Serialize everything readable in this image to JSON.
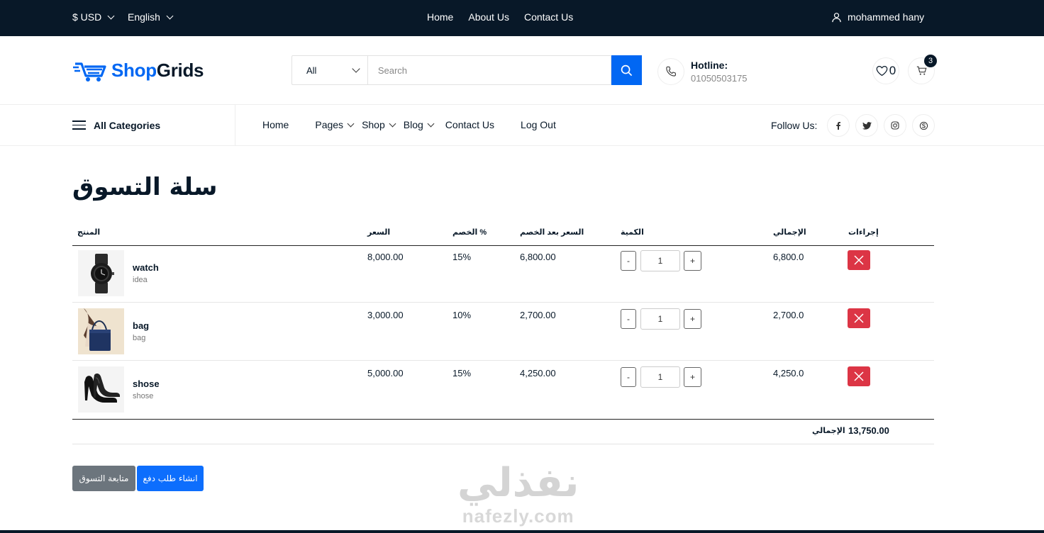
{
  "topbar": {
    "currency": "$ USD",
    "language": "English",
    "nav": [
      "Home",
      "About Us",
      "Contact Us"
    ],
    "user": "mohammed hany"
  },
  "header": {
    "logo_shop": "Shop",
    "logo_grids": "Grids",
    "search_category": "All",
    "search_placeholder": "Search",
    "hotline_label": "Hotline:",
    "hotline_number": "01050503175",
    "wishlist_count": "0",
    "cart_count": "3"
  },
  "navbar": {
    "all_categories": "All Categories",
    "menu": [
      {
        "label": "Home",
        "dropdown": false
      },
      {
        "label": "Pages",
        "dropdown": true
      },
      {
        "label": "Shop",
        "dropdown": true
      },
      {
        "label": "Blog",
        "dropdown": true
      },
      {
        "label": "Contact Us",
        "dropdown": false
      },
      {
        "label": "Log Out",
        "dropdown": false
      }
    ],
    "follow_label": "Follow Us:",
    "social_icons": [
      "facebook-icon",
      "twitter-icon",
      "instagram-icon",
      "skype-icon"
    ]
  },
  "cart": {
    "title": "سلة التسوق",
    "headers": {
      "product": "المنتج",
      "price": "السعر",
      "discount": "الخصم %",
      "price_after": "السعر بعد الخصم",
      "quantity": "الكمية",
      "total": "الإجمالي",
      "actions": "إجراءات"
    },
    "items": [
      {
        "name": "watch",
        "desc": "idea",
        "price": "8,000.00",
        "discount": "15%",
        "price_after": "6,800.00",
        "qty": "1",
        "total": "6,800.0",
        "minus": "-",
        "plus": "+"
      },
      {
        "name": "bag",
        "desc": "bag",
        "price": "3,000.00",
        "discount": "10%",
        "price_after": "2,700.00",
        "qty": "1",
        "total": "2,700.0",
        "minus": "-",
        "plus": "+"
      },
      {
        "name": "shose",
        "desc": "shose",
        "price": "5,000.00",
        "discount": "15%",
        "price_after": "4,250.00",
        "qty": "1",
        "total": "4,250.0",
        "minus": "-",
        "plus": "+"
      }
    ],
    "grand_total_label": "الإجمالي",
    "grand_total_value": "13,750.00",
    "continue_label": "متابعة التسوق",
    "checkout_label": "انشاء طلب دفع"
  },
  "watermark": {
    "arabic": "نفذلي",
    "latin": "nafezly.com"
  },
  "colors": {
    "dark": "#081828",
    "primary": "#0167f3",
    "danger": "#dc3545",
    "secondary": "#6c757d"
  }
}
